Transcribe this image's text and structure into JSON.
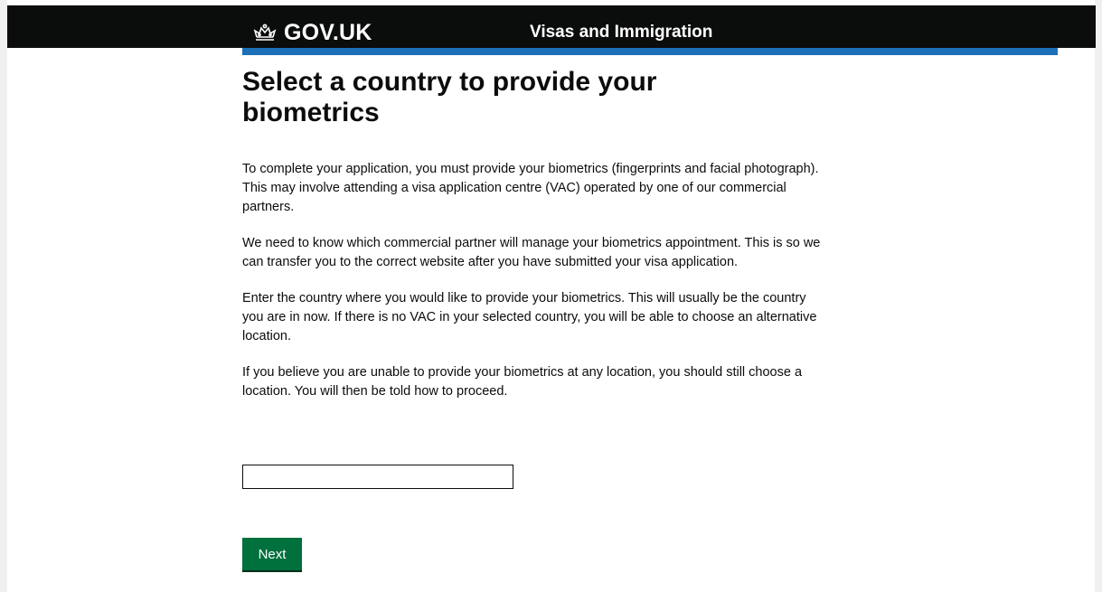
{
  "header": {
    "logo_text": "GOV.UK",
    "logo_icon": "crown-icon",
    "service_name": "Visas and Immigration"
  },
  "page": {
    "title": "Select a country to provide your biometrics",
    "paragraphs": [
      "To complete your application, you must provide your biometrics (fingerprints and facial photograph). This may involve attending a visa application centre (VAC) operated by one of our commercial partners.",
      "We need to know which commercial partner will manage your biometrics appointment. This is so we can transfer you to the correct website after you have submitted your visa application.",
      "Enter the country where you would like to provide your biometrics. This will usually be the country you are in now. If there is no VAC in your selected country, you will be able to choose an alternative location.",
      "If you believe you are unable to provide your biometrics at any location, you should still choose a location. You will then be told how to proceed."
    ]
  },
  "form": {
    "country_value": "",
    "next_label": "Next"
  },
  "colors": {
    "header_bg": "#0b0c0c",
    "accent_blue": "#1d70b8",
    "button_green": "#00703c"
  }
}
